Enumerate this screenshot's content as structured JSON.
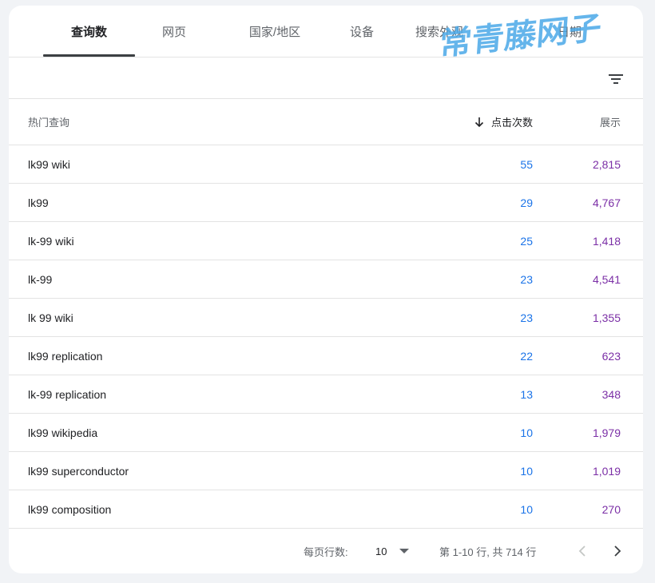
{
  "tabs": [
    {
      "label": "查询数",
      "active": true
    },
    {
      "label": "网页",
      "active": false
    },
    {
      "label": "国家/地区",
      "active": false
    },
    {
      "label": "设备",
      "active": false
    },
    {
      "label": "搜索外观",
      "active": false
    },
    {
      "label": "日期",
      "active": false
    }
  ],
  "watermark": "常青藤网子",
  "filter_icon": "filter-list-icon",
  "table": {
    "headers": {
      "query": "热门查询",
      "clicks": "点击次数",
      "impressions": "展示"
    },
    "sort_icon": "arrow-downward-icon",
    "rows": [
      {
        "query": "lk99 wiki",
        "clicks": "55",
        "impressions": "2,815"
      },
      {
        "query": "lk99",
        "clicks": "29",
        "impressions": "4,767"
      },
      {
        "query": "lk-99 wiki",
        "clicks": "25",
        "impressions": "1,418"
      },
      {
        "query": "lk-99",
        "clicks": "23",
        "impressions": "4,541"
      },
      {
        "query": "lk 99 wiki",
        "clicks": "23",
        "impressions": "1,355"
      },
      {
        "query": "lk99 replication",
        "clicks": "22",
        "impressions": "623"
      },
      {
        "query": "lk-99 replication",
        "clicks": "13",
        "impressions": "348"
      },
      {
        "query": "lk99 wikipedia",
        "clicks": "10",
        "impressions": "1,979"
      },
      {
        "query": "lk99 superconductor",
        "clicks": "10",
        "impressions": "1,019"
      },
      {
        "query": "lk99 composition",
        "clicks": "10",
        "impressions": "270"
      }
    ]
  },
  "pagination": {
    "rows_per_page_label": "每页行数:",
    "rows_per_page_value": "10",
    "range_text": "第 1-10 行, 共 714 行"
  },
  "colors": {
    "clicks": "#1a73e8",
    "impressions": "#7b2fa6",
    "watermark": "#4aa8e8"
  }
}
